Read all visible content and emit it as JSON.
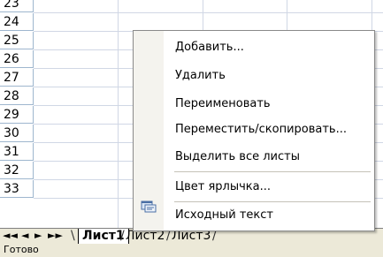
{
  "sheet": {
    "rows": [
      "23",
      "24",
      "25",
      "26",
      "27",
      "28",
      "29",
      "30",
      "31",
      "32",
      "33"
    ]
  },
  "tabs": {
    "nav": [
      "◄◄",
      "◄",
      "►",
      "►►"
    ],
    "sheets": [
      "Лист1",
      "Лист2",
      "Лист3"
    ]
  },
  "status": "Готово",
  "context_menu": {
    "items": [
      "Добавить...",
      "Удалить",
      "Переименовать",
      "Переместить/скопировать...",
      "Выделить все листы",
      "Цвет ярлычка...",
      "Исходный текст"
    ]
  }
}
